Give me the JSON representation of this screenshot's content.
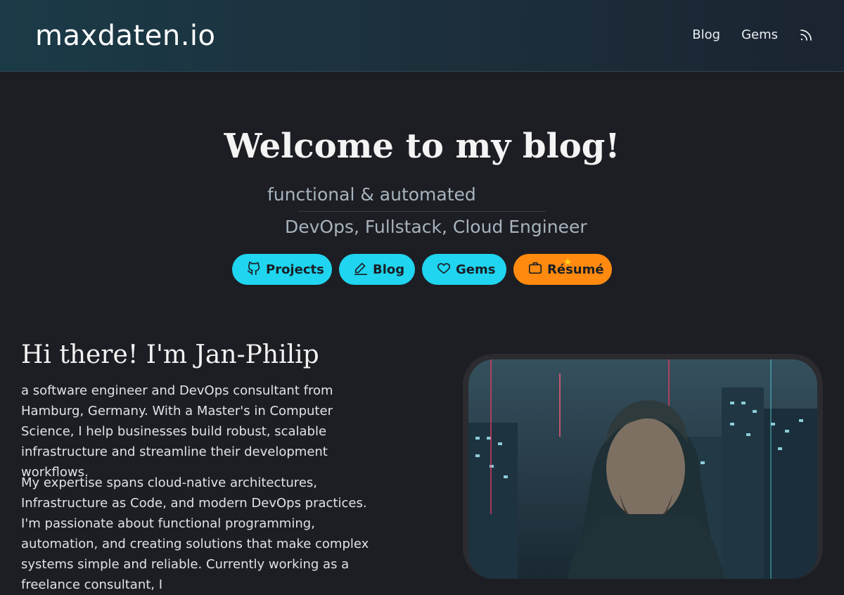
{
  "header": {
    "logo": "maxdaten.io",
    "nav": [
      {
        "label": "Blog"
      },
      {
        "label": "Gems"
      }
    ],
    "rss_icon": "rss-icon"
  },
  "hero": {
    "title": "Welcome to my blog!",
    "tagline_1": "functional & automated",
    "tagline_2": "DevOps, Fullstack, Cloud Engineer",
    "buttons": [
      {
        "label": "Projects",
        "icon": "github-icon",
        "color": "#1fd5ef"
      },
      {
        "label": "Blog",
        "icon": "pencil-icon",
        "color": "#1fd5ef"
      },
      {
        "label": "Gems",
        "icon": "heart-icon",
        "color": "#1fd5ef"
      },
      {
        "label": "Résumé",
        "icon": "briefcase-icon",
        "color": "#ff8a0f"
      }
    ]
  },
  "intro": {
    "title": "Hi there! I'm Jan-Philip",
    "paragraph_1": "a software engineer and DevOps consultant from Hamburg, Germany. With a Master's in Computer Science, I help businesses build robust, scalable infrastructure and streamline their development workflows.",
    "paragraph_2": "My expertise spans cloud-native architectures, Infrastructure as Code, and modern DevOps practices. I'm passionate about functional programming, automation, and creating solutions that make complex systems simple and reliable. Currently working as a freelance consultant, I"
  },
  "colors": {
    "background": "#1d1e24",
    "accent": "#1fd5ef",
    "resume_accent": "#ff8a0f"
  }
}
